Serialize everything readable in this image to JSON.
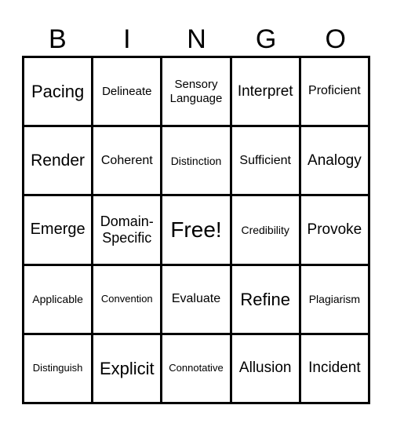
{
  "header": [
    "B",
    "I",
    "N",
    "G",
    "O"
  ],
  "cells": [
    [
      "Pacing",
      "Delineate",
      "Sensory Language",
      "Interpret",
      "Proficient"
    ],
    [
      "Render",
      "Coherent",
      "Distinction",
      "Sufficient",
      "Analogy"
    ],
    [
      "Emerge",
      "Domain-Specific",
      "Free!",
      "Credibility",
      "Provoke"
    ],
    [
      "Applicable",
      "Convention",
      "Evaluate",
      "Refine",
      "Plagiarism"
    ],
    [
      "Distinguish",
      "Explicit",
      "Connotative",
      "Allusion",
      "Incident"
    ]
  ],
  "free_space": "Free!"
}
